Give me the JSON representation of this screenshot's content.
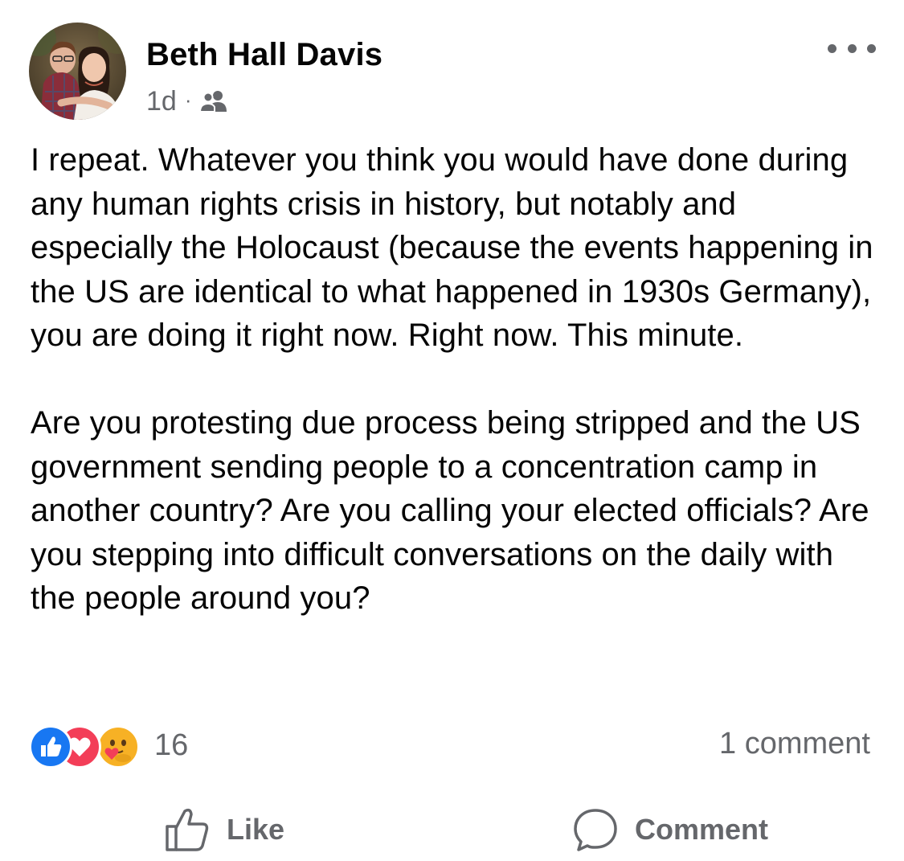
{
  "post": {
    "author": "Beth Hall Davis",
    "timestamp": "1d",
    "separator": "·",
    "audience_icon": "friends-icon",
    "more_icon": "more-horizontal-icon",
    "paragraphs": [
      "I repeat. Whatever you think you would have done during any human rights crisis in history, but notably and especially the Holocaust (because the events happening in the US are identical to what happened in 1930s Germany), you are doing it right now. Right now. This minute.",
      "Are you protesting due process being stripped and the US government sending people to a concentration camp in another country? Are you calling your elected officials? Are you stepping into difficult conversations on the daily with the people around you?"
    ]
  },
  "engagement": {
    "reaction_icons": [
      "like-reaction-icon",
      "love-reaction-icon",
      "care-reaction-icon"
    ],
    "reaction_count": "16",
    "comment_count": "1 comment"
  },
  "actions": {
    "like_label": "Like",
    "comment_label": "Comment",
    "like_icon": "thumbs-up-icon",
    "comment_icon": "speech-bubble-icon"
  },
  "colors": {
    "text_primary": "#050505",
    "text_secondary": "#65676b",
    "like_blue": "#1877f2",
    "love_red": "#f33e58",
    "care_yellow": "#f7b125",
    "background": "#ffffff"
  }
}
